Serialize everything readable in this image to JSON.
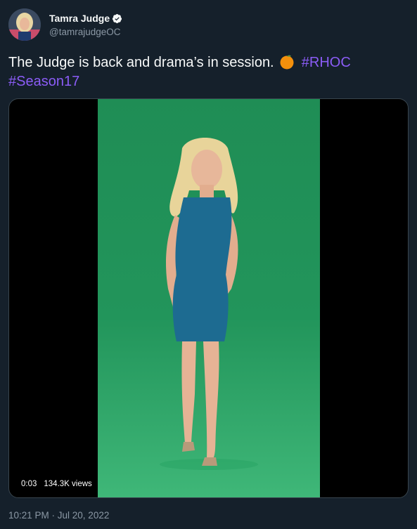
{
  "author": {
    "display_name": "Tamra Judge",
    "handle": "@tamrajudgeOC",
    "verified_icon": "verified-badge-icon"
  },
  "tweet": {
    "text": "The Judge is back and drama’s in session.",
    "emoji_icon": "orange-emoji-icon",
    "hashtags": [
      "#RHOC",
      "#Season17"
    ]
  },
  "video": {
    "elapsed": "0:03",
    "views": "134.3K views"
  },
  "meta": {
    "timestamp": "10:21 PM · Jul 20, 2022"
  },
  "colors": {
    "background": "#15202b",
    "hashtag": "#8b5cf6",
    "muted": "#8b98a5",
    "greenscreen": "#22955b"
  }
}
